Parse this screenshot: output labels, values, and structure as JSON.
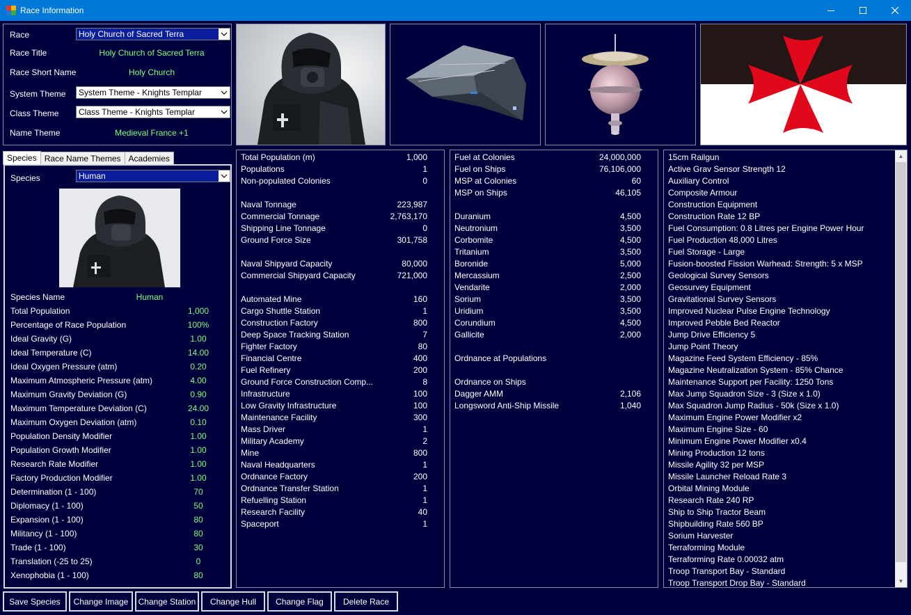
{
  "window": {
    "title": "Race Information",
    "icon": "app-grid-icon",
    "icon_colors": [
      "#e23c2c",
      "#f4b400",
      "#2c72d6",
      "#3caa3c"
    ]
  },
  "race": {
    "race_label": "Race",
    "race_value": "Holy Church of Sacred Terra",
    "race_title_label": "Race Title",
    "race_title_value": "Holy Church of Sacred Terra",
    "short_name_label": "Race Short Name",
    "short_name_value": "Holy Church",
    "system_theme_label": "System Theme",
    "system_theme_value": "System Theme - Knights Templar",
    "class_theme_label": "Class Theme",
    "class_theme_value": "Class Theme - Knights Templar",
    "name_theme_label": "Name Theme",
    "name_theme_value": "Medieval France +1"
  },
  "flag": {
    "top_color": "#221715",
    "bottom_color": "#ffffff",
    "cross_color": "#e1081c"
  },
  "tabs": [
    "Species",
    "Race Name Themes",
    "Academies"
  ],
  "species": {
    "label": "Species",
    "value": "Human",
    "stats": [
      {
        "label": "Species Name",
        "value": "Human"
      },
      {
        "label": "Total Population",
        "value": "1,000"
      },
      {
        "label": "Percentage of Race Population",
        "value": "100%"
      },
      {
        "label": "Ideal Gravity (G)",
        "value": "1.00"
      },
      {
        "label": "Ideal Temperature (C)",
        "value": "14.00"
      },
      {
        "label": "Ideal Oxygen Pressure (atm)",
        "value": "0.20"
      },
      {
        "label": "Maximum Atmospheric Pressure (atm)",
        "value": "4.00"
      },
      {
        "label": "Maximum Gravity Deviation (G)",
        "value": "0.90"
      },
      {
        "label": "Maximum Temperature Deviation (C)",
        "value": "24.00"
      },
      {
        "label": "Maximum Oxygen Deviation (atm)",
        "value": "0.10"
      },
      {
        "label": "Population Density Modifier",
        "value": "1.00"
      },
      {
        "label": "Population Growth Modifier",
        "value": "1.00"
      },
      {
        "label": "Research Rate Modifier",
        "value": "1.00"
      },
      {
        "label": "Factory Production Modifier",
        "value": "1.00"
      },
      {
        "label": "Determination (1 - 100)",
        "value": "70"
      },
      {
        "label": "Diplomacy (1 - 100)",
        "value": "50"
      },
      {
        "label": "Expansion (1 - 100)",
        "value": "80"
      },
      {
        "label": "Militancy (1 - 100)",
        "value": "80"
      },
      {
        "label": "Trade (1 - 100)",
        "value": "30"
      },
      {
        "label": "Translation (-25 to 25)",
        "value": "0"
      },
      {
        "label": "Xenophobia (1 - 100)",
        "value": "80"
      }
    ]
  },
  "summary": [
    {
      "label": "Total Population (m)",
      "value": "1,000"
    },
    {
      "label": "Populations",
      "value": "1"
    },
    {
      "label": "Non-populated Colonies",
      "value": "0"
    },
    {
      "label": "",
      "value": ""
    },
    {
      "label": "Naval Tonnage",
      "value": "223,987"
    },
    {
      "label": "Commercial Tonnage",
      "value": "2,763,170"
    },
    {
      "label": "Shipping Line Tonnage",
      "value": "0"
    },
    {
      "label": "Ground Force Size",
      "value": "301,758"
    },
    {
      "label": "",
      "value": ""
    },
    {
      "label": "Naval Shipyard Capacity",
      "value": "80,000"
    },
    {
      "label": "Commercial Shipyard Capacity",
      "value": "721,000"
    },
    {
      "label": "",
      "value": ""
    },
    {
      "label": "Automated Mine",
      "value": "160"
    },
    {
      "label": "Cargo Shuttle Station",
      "value": "1"
    },
    {
      "label": "Construction Factory",
      "value": "800"
    },
    {
      "label": "Deep Space Tracking Station",
      "value": "7"
    },
    {
      "label": "Fighter Factory",
      "value": "80"
    },
    {
      "label": "Financial Centre",
      "value": "400"
    },
    {
      "label": "Fuel Refinery",
      "value": "200"
    },
    {
      "label": "Ground Force Construction Comp...",
      "value": "8"
    },
    {
      "label": "Infrastructure",
      "value": "100"
    },
    {
      "label": "Low Gravity Infrastructure",
      "value": "100"
    },
    {
      "label": "Maintenance Facility",
      "value": "300"
    },
    {
      "label": "Mass Driver",
      "value": "1"
    },
    {
      "label": "Military Academy",
      "value": "2"
    },
    {
      "label": "Mine",
      "value": "800"
    },
    {
      "label": "Naval Headquarters",
      "value": "1"
    },
    {
      "label": "Ordnance Factory",
      "value": "200"
    },
    {
      "label": "Ordnance Transfer Station",
      "value": "1"
    },
    {
      "label": "Refuelling Station",
      "value": "1"
    },
    {
      "label": "Research Facility",
      "value": "40"
    },
    {
      "label": "Spaceport",
      "value": "1"
    }
  ],
  "resources": [
    {
      "label": "Fuel at Colonies",
      "value": "24,000,000"
    },
    {
      "label": "Fuel on Ships",
      "value": "76,106,000"
    },
    {
      "label": "MSP at Colonies",
      "value": "60"
    },
    {
      "label": "MSP on Ships",
      "value": "46,105"
    },
    {
      "label": "",
      "value": ""
    },
    {
      "label": "Duranium",
      "value": "4,500"
    },
    {
      "label": "Neutronium",
      "value": "3,500"
    },
    {
      "label": "Corbomite",
      "value": "4,500"
    },
    {
      "label": "Tritanium",
      "value": "3,500"
    },
    {
      "label": "Boronide",
      "value": "5,000"
    },
    {
      "label": "Mercassium",
      "value": "2,500"
    },
    {
      "label": "Vendarite",
      "value": "2,000"
    },
    {
      "label": "Sorium",
      "value": "3,500"
    },
    {
      "label": "Uridium",
      "value": "3,500"
    },
    {
      "label": "Corundium",
      "value": "4,500"
    },
    {
      "label": "Gallicite",
      "value": "2,000"
    },
    {
      "label": "",
      "value": ""
    },
    {
      "label": "Ordnance at Populations",
      "value": ""
    },
    {
      "label": "",
      "value": ""
    },
    {
      "label": "Ordnance on Ships",
      "value": ""
    },
    {
      "label": "Dagger AMM",
      "value": "2,106"
    },
    {
      "label": "Longsword Anti-Ship Missile",
      "value": "1,040"
    }
  ],
  "technologies": [
    "15cm Railgun",
    "Active Grav Sensor Strength 12",
    "Auxiliary Control",
    "Composite Armour",
    "Construction Equipment",
    "Construction Rate 12 BP",
    "Fuel Consumption: 0.8 Litres per Engine Power Hour",
    "Fuel Production 48,000 Litres",
    "Fuel Storage - Large",
    "Fusion-boosted Fission Warhead: Strength: 5 x MSP",
    "Geological Survey Sensors",
    "Geosurvey Equipment",
    "Gravitational Survey Sensors",
    "Improved Nuclear Pulse Engine Technology",
    "Improved Pebble Bed Reactor",
    "Jump Drive Efficiency 5",
    "Jump Point Theory",
    "Magazine Feed System Efficiency - 85%",
    "Magazine Neutralization System - 85% Chance",
    "Maintenance Support per Facility: 1250 Tons",
    "Max Jump Squadron Size - 3 (Size x 1.0)",
    "Max Squadron Jump Radius - 50k (Size x 1.0)",
    "Maximum Engine Power Modifier x2",
    "Maximum Engine Size - 60",
    "Minimum Engine Power Modifier x0.4",
    "Mining Production 12 tons",
    "Missile Agility 32 per MSP",
    "Missile Launcher Reload Rate 3",
    "Orbital Mining Module",
    "Research Rate 240 RP",
    "Ship to Ship Tractor Beam",
    "Shipbuilding Rate 560 BP",
    "Sorium Harvester",
    "Terraforming Module",
    "Terraforming Rate 0.00032 atm",
    "Troop Transport Bay - Standard",
    "Troop Transport Drop Bay - Standard"
  ],
  "buttons": [
    "Save Species",
    "Change Image",
    "Change Station",
    "Change Hull",
    "Change Flag",
    "Delete Race"
  ]
}
